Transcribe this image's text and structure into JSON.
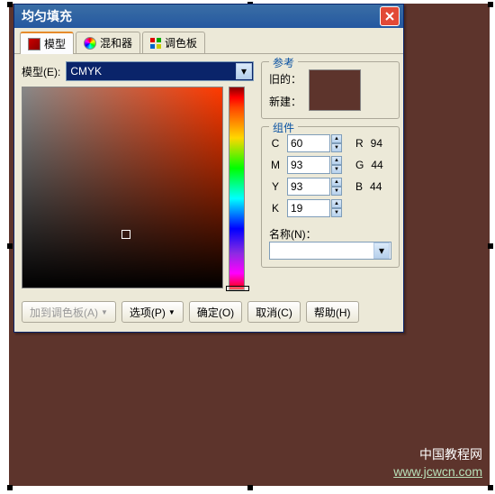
{
  "canvas": {
    "fill": "#5d342c"
  },
  "dialog": {
    "title": "均匀填充",
    "tabs": [
      {
        "label": "模型",
        "active": true
      },
      {
        "label": "混和器"
      },
      {
        "label": "调色板"
      }
    ],
    "model": {
      "label": "模型(E):",
      "value": "CMYK"
    },
    "reference": {
      "legend": "参考",
      "old_label": "旧的：",
      "new_label": "新建："
    },
    "components": {
      "legend": "组件",
      "items": [
        {
          "key": "C",
          "val": "60",
          "rgb_key": "R",
          "rgb_val": "94"
        },
        {
          "key": "M",
          "val": "93",
          "rgb_key": "G",
          "rgb_val": "44"
        },
        {
          "key": "Y",
          "val": "93",
          "rgb_key": "B",
          "rgb_val": "44"
        },
        {
          "key": "K",
          "val": "19"
        }
      ]
    },
    "name": {
      "label": "名称(N)：",
      "value": ""
    },
    "buttons": {
      "add_palette": "加到调色板(A)",
      "options": "选项(P)",
      "ok": "确定(O)",
      "cancel": "取消(C)",
      "help": "帮助(H)"
    }
  },
  "watermark": {
    "line1": "中国教程网",
    "line2": "www.jcwcn.com"
  }
}
